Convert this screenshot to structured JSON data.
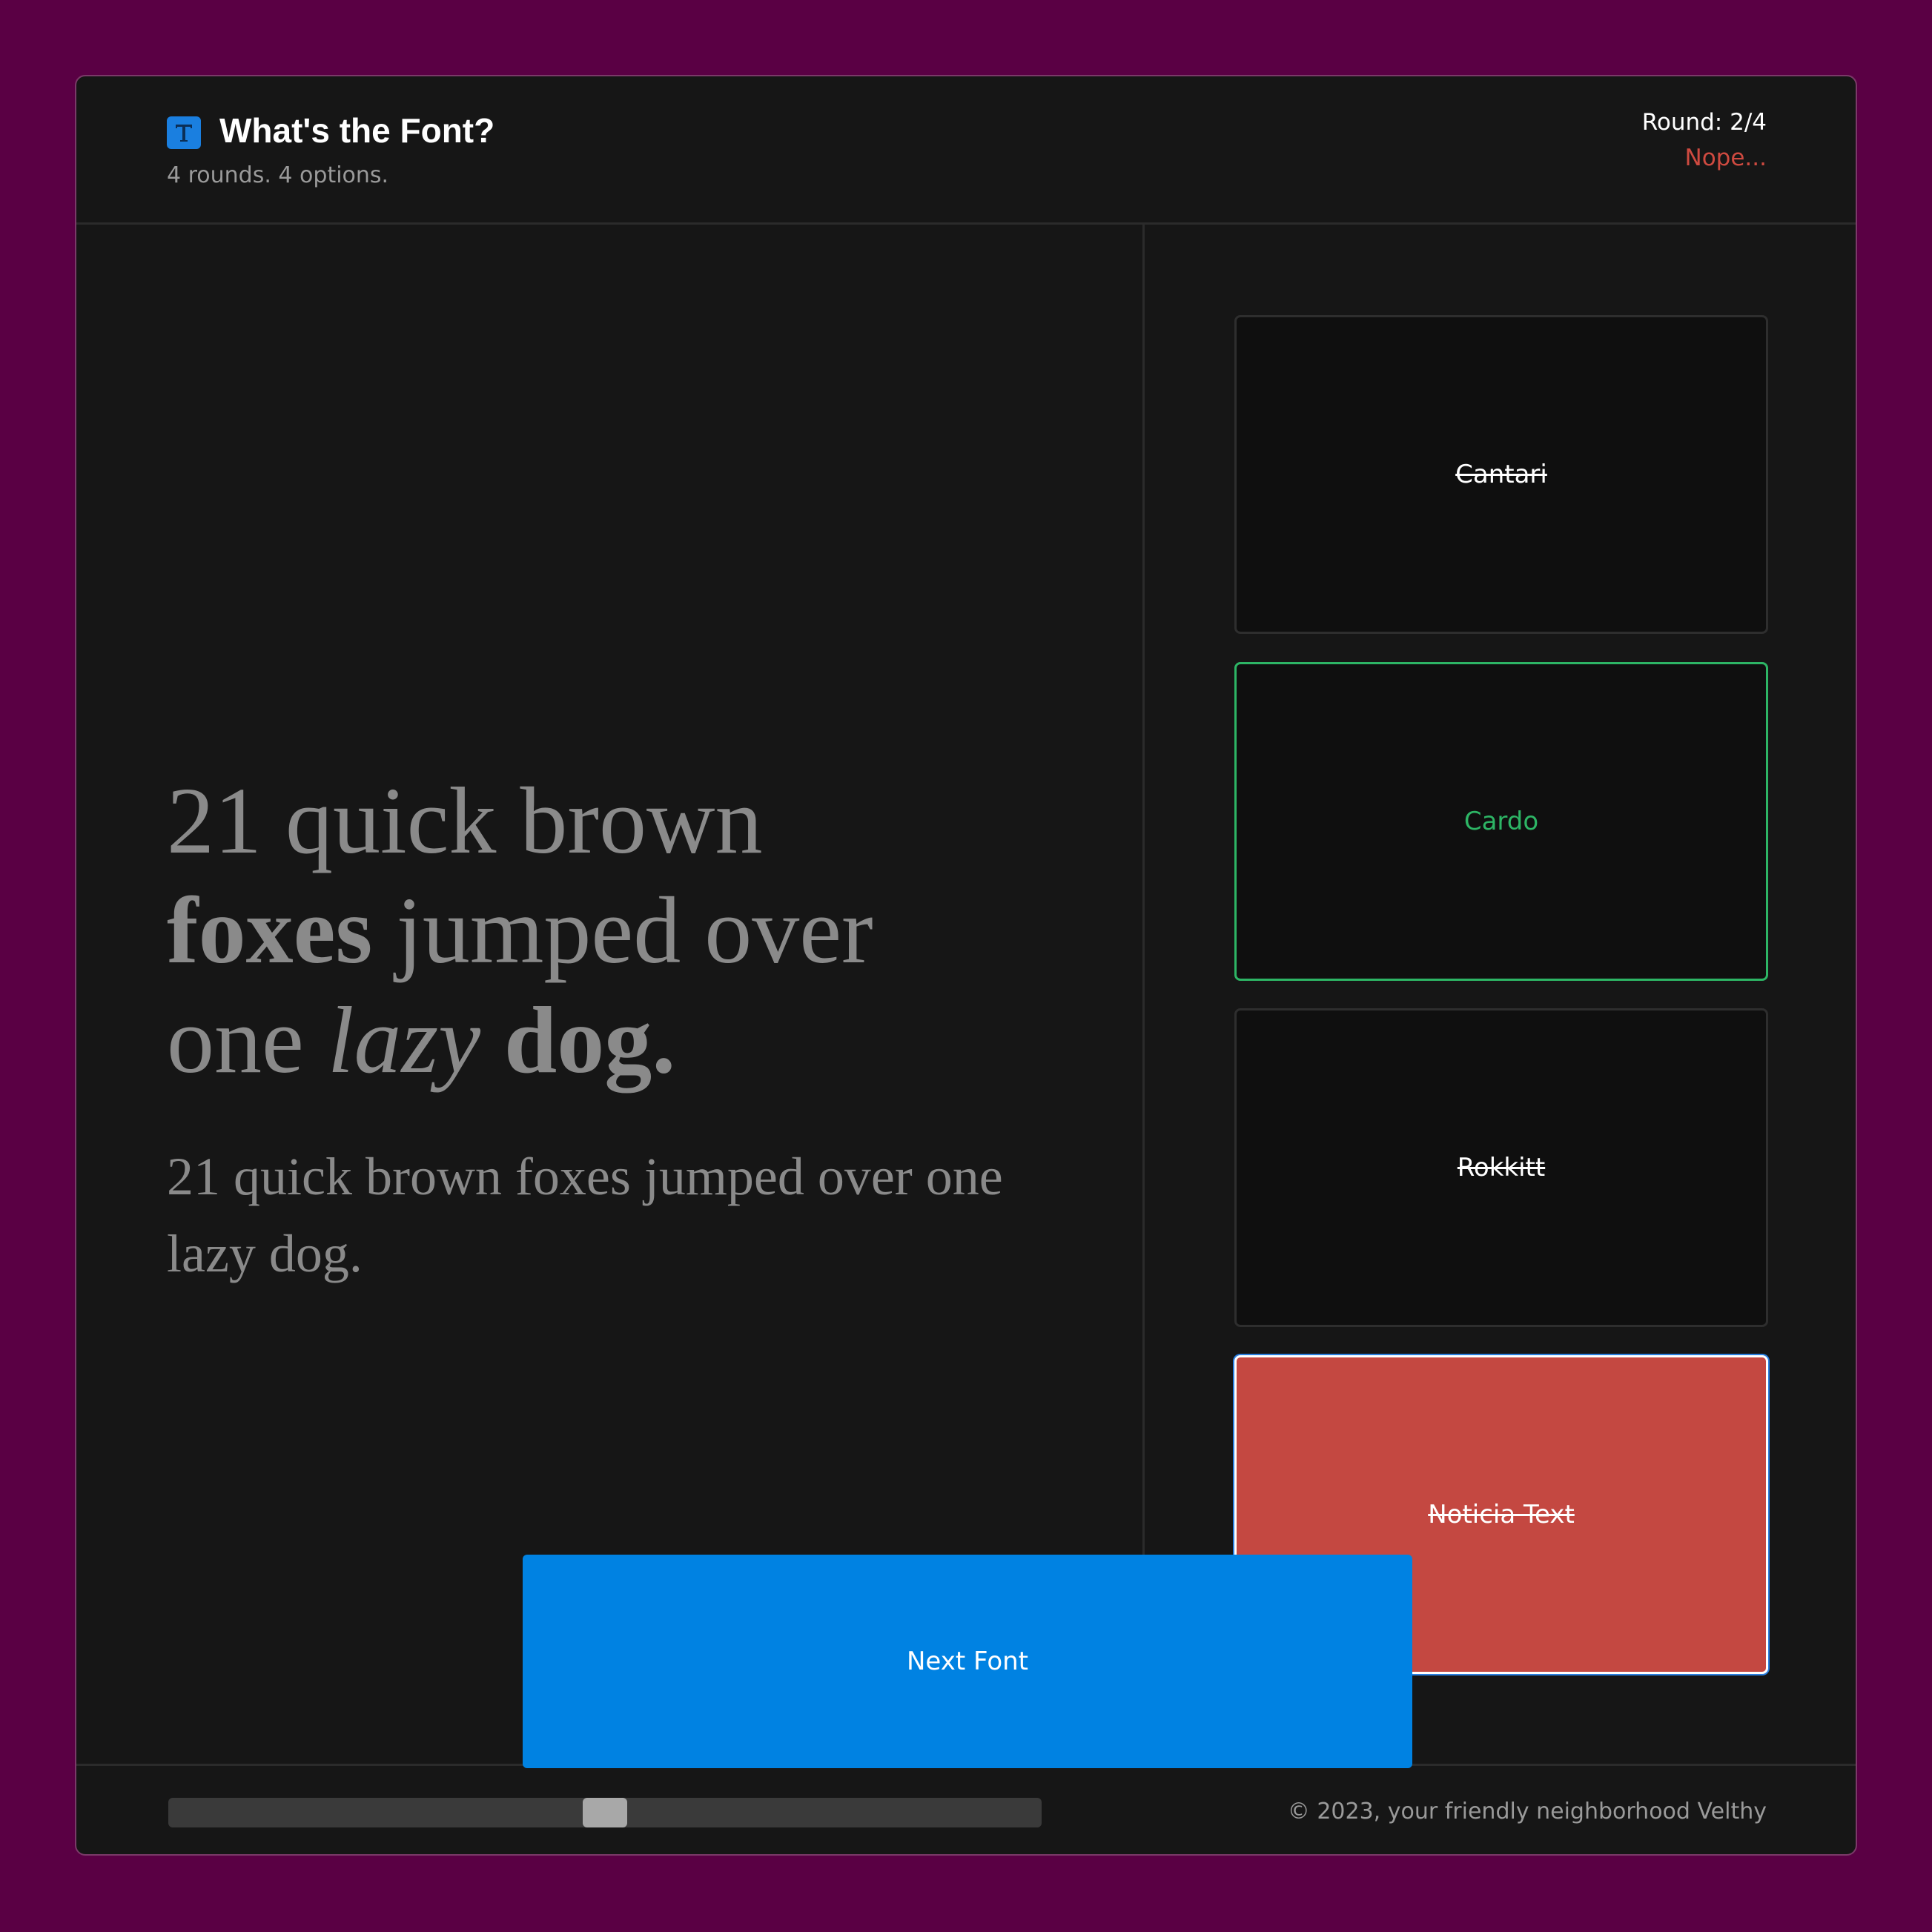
{
  "header": {
    "title": "What's the Font?",
    "subtitle": "4 rounds. 4 options.",
    "round": "Round: 2/4",
    "status": "Nope...",
    "logo_icon": "t-letter-icon"
  },
  "sample": {
    "large_line1": "21 quick brown",
    "large_line2_bold": "foxes",
    "large_line2_rest": " jumped over",
    "large_line3_start": "one ",
    "large_line3_italic": "lazy",
    "large_line3_space": " ",
    "large_line3_bold": "dog.",
    "small": "21 quick brown foxes jumped over one lazy dog."
  },
  "options": [
    {
      "label": "Cantari",
      "state": "wrong"
    },
    {
      "label": "Cardo",
      "state": "correct"
    },
    {
      "label": "Rokkitt",
      "state": "wrong"
    },
    {
      "label": "Noticia Text",
      "state": "selected-wrong"
    }
  ],
  "next_button": {
    "label": "Next Font"
  },
  "footer": {
    "copyright": "© 2023, your friendly neighborhood Velthy",
    "scroll_position": 0.5
  },
  "colors": {
    "background": "#5a0044",
    "panel": "#161616",
    "accent_blue": "#0082e2",
    "correct_green": "#2db565",
    "wrong_red": "#c44841"
  }
}
